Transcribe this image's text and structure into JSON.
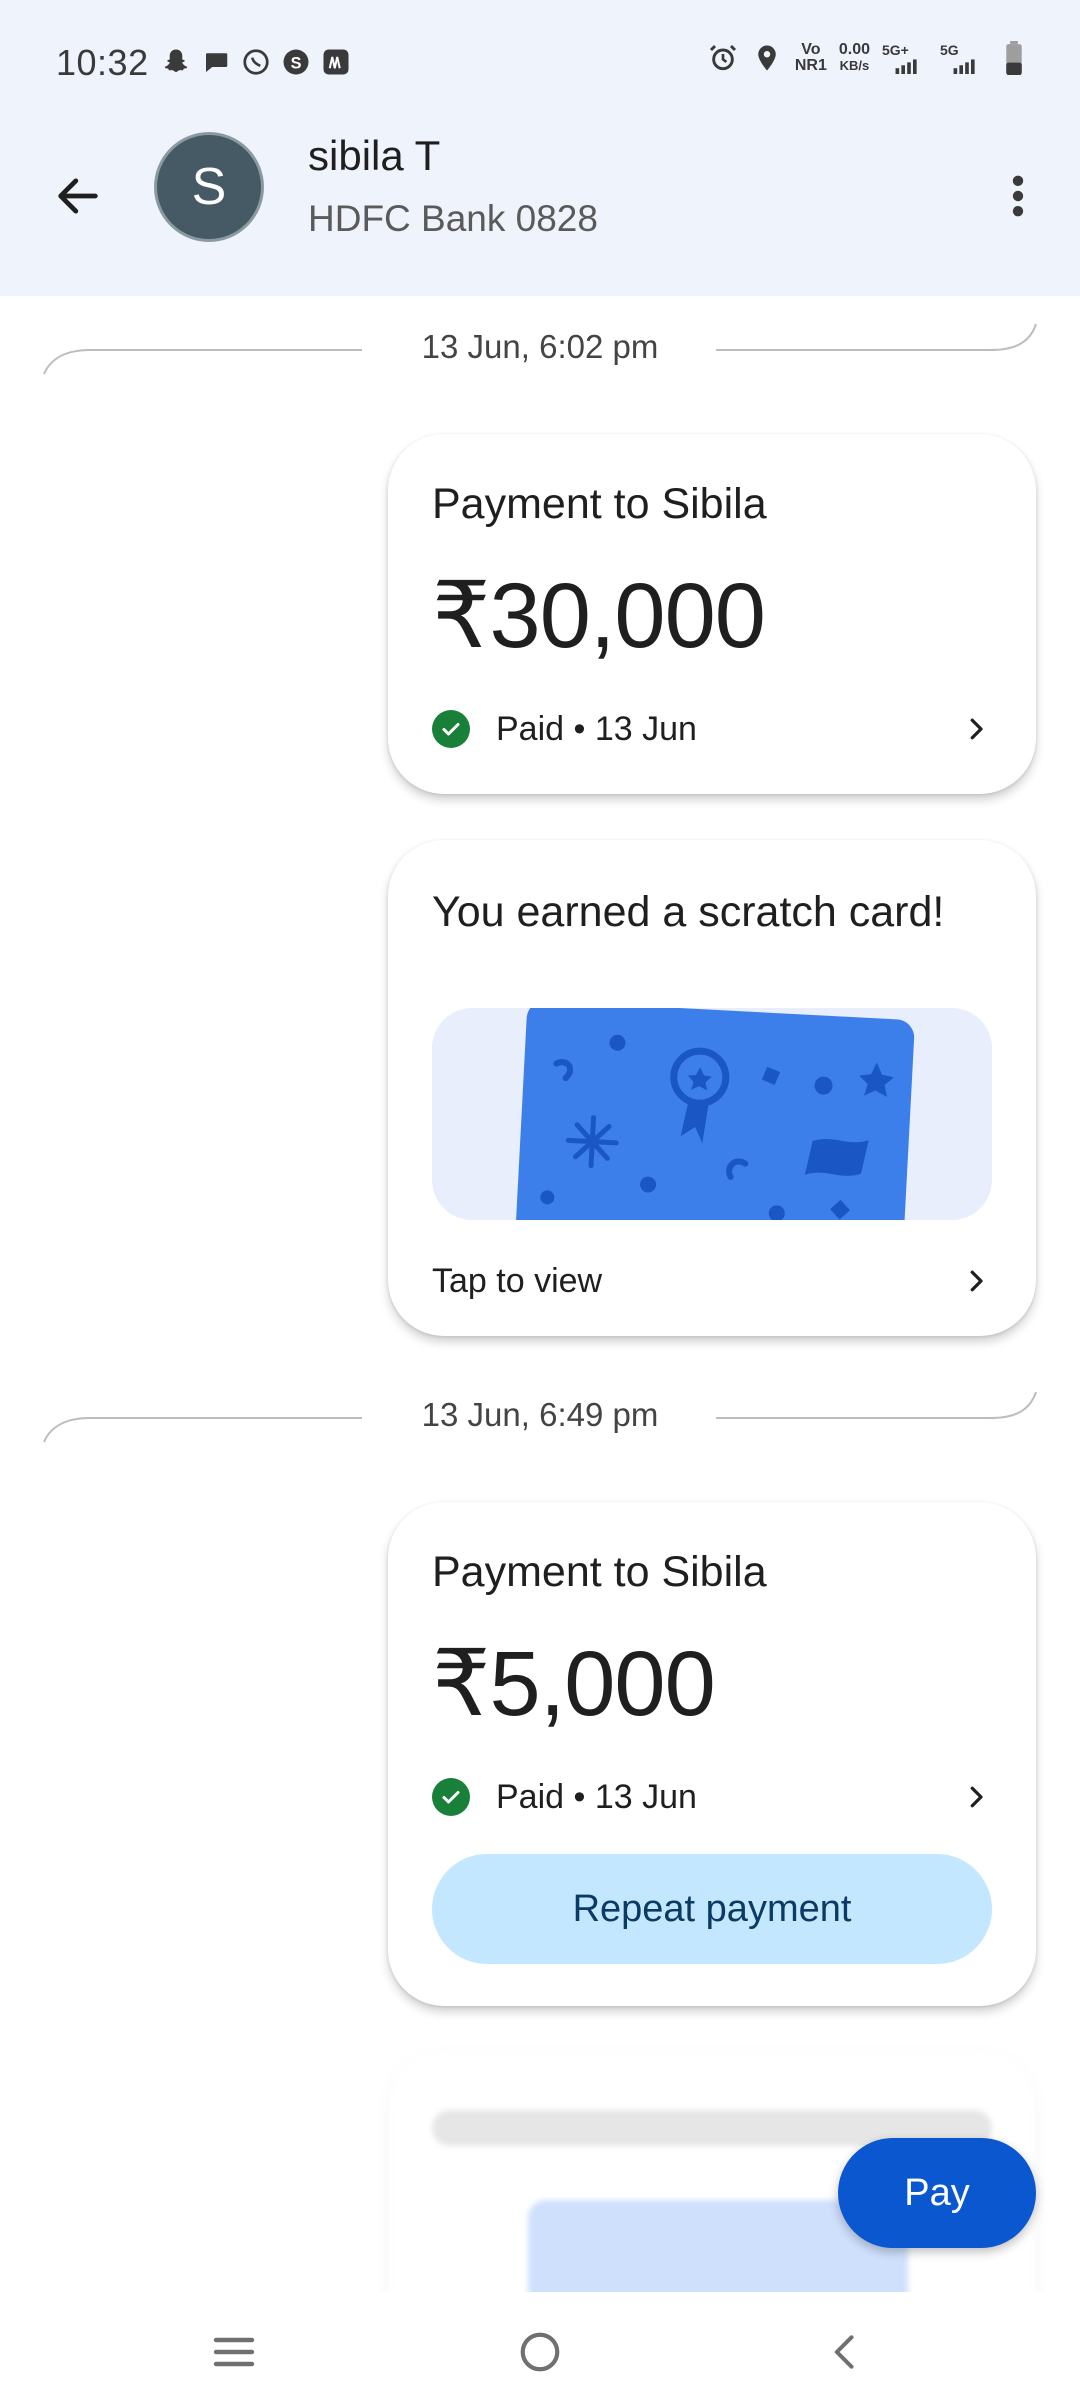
{
  "status_bar": {
    "time": "10:32",
    "network_label_1": "Vo",
    "network_label_2": "NR1",
    "speed_value": "0.00",
    "speed_unit": "KB/s",
    "signal_1_label": "5G+",
    "signal_2_label": "5G"
  },
  "header": {
    "avatar_letter": "S",
    "name": "sibila T",
    "bank": "HDFC Bank 0828"
  },
  "dividers": [
    {
      "timestamp": "13 Jun, 6:02 pm"
    },
    {
      "timestamp": "13 Jun, 6:49 pm"
    }
  ],
  "payment_1": {
    "title": "Payment to Sibila",
    "amount": "₹30,000",
    "status": "Paid • 13 Jun"
  },
  "scratch": {
    "title": "You earned a scratch card!",
    "action": "Tap to view"
  },
  "payment_2": {
    "title": "Payment to Sibila",
    "amount": "₹5,000",
    "status": "Paid • 13 Jun",
    "repeat_label": "Repeat payment"
  },
  "fab": {
    "pay_label": "Pay"
  },
  "colors": {
    "header_bg": "#eff3fb",
    "success_green": "#188038",
    "primary_blue": "#0b57d0",
    "repeat_bg": "#c2e7ff",
    "scratch_blue": "#3d7fea"
  }
}
